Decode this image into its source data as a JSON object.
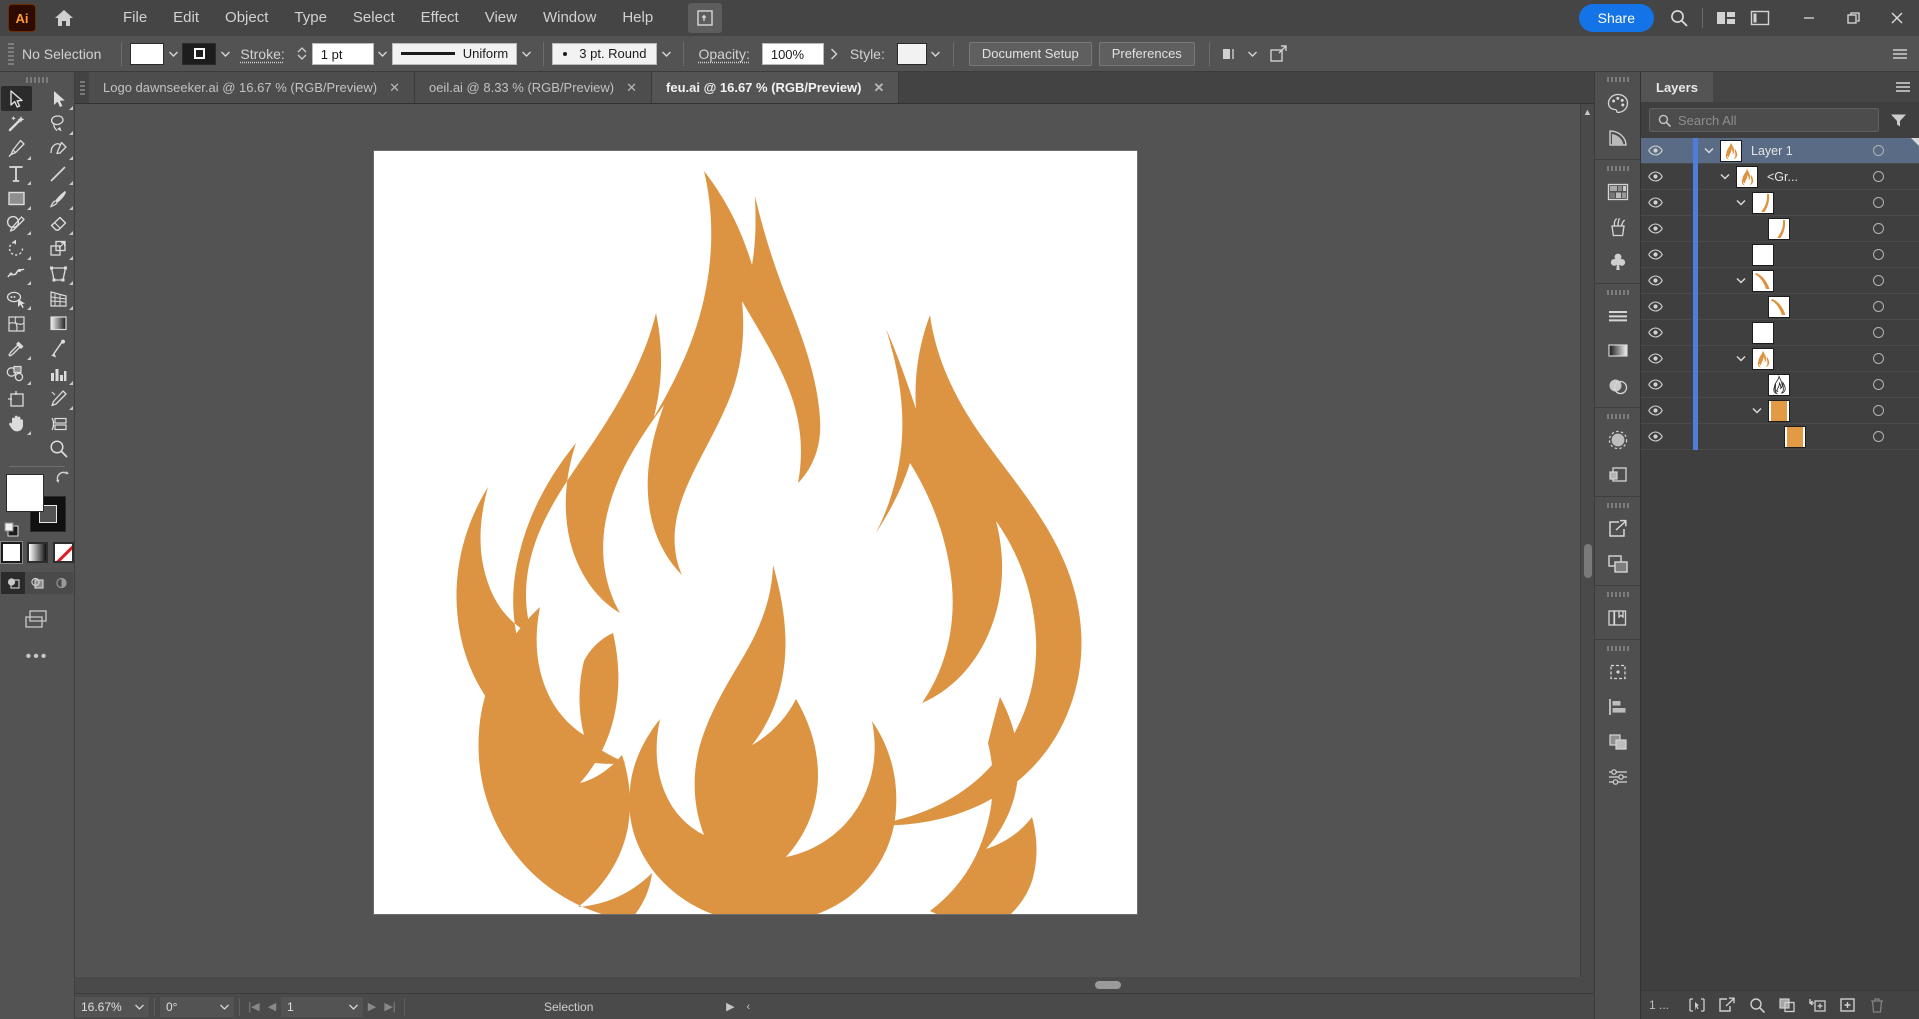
{
  "app": {
    "name": "Adobe Illustrator",
    "logo_text": "Ai"
  },
  "menubar": {
    "items": [
      {
        "label": "File"
      },
      {
        "label": "Edit"
      },
      {
        "label": "Object"
      },
      {
        "label": "Type"
      },
      {
        "label": "Select"
      },
      {
        "label": "Effect"
      },
      {
        "label": "View"
      },
      {
        "label": "Window"
      },
      {
        "label": "Help"
      }
    ],
    "share_label": "Share",
    "icons": {
      "home": "home-icon",
      "doc_arrange": "document-arrange-icon",
      "search": "search-icon",
      "workspace": "workspace-switcher-icon",
      "panel_toggle": "panel-toggle-icon",
      "minimize": "–",
      "maximize": "❐",
      "close": "✕"
    }
  },
  "controlbar": {
    "selection_status": "No Selection",
    "fill_color": "#ffffff",
    "stroke_color": "#1d1d1d",
    "stroke_label": "Stroke:",
    "stroke_weight": "1 pt",
    "stroke_profile": "Uniform",
    "stroke_cap": "3 pt. Round",
    "opacity_label": "Opacity:",
    "opacity_value": "100%",
    "style_label": "Style:",
    "document_setup_label": "Document Setup",
    "preferences_label": "Preferences"
  },
  "tabs": [
    {
      "label": "Logo dawnseeker.ai @ 16.67 % (RGB/Preview)",
      "active": false,
      "close": "✕"
    },
    {
      "label": "oeil.ai @ 8.33 % (RGB/Preview)",
      "active": false,
      "close": "✕"
    },
    {
      "label": "feu.ai @ 16.67 % (RGB/Preview)",
      "active": true,
      "close": "✕"
    }
  ],
  "toolbar": {
    "tools": [
      {
        "name": "selection-tool",
        "active": true
      },
      {
        "name": "direct-selection-tool",
        "active": false
      },
      {
        "name": "magic-wand-tool",
        "active": false
      },
      {
        "name": "lasso-tool",
        "active": false
      },
      {
        "name": "pen-tool",
        "active": false
      },
      {
        "name": "curvature-tool",
        "active": false
      },
      {
        "name": "type-tool",
        "active": false
      },
      {
        "name": "line-segment-tool",
        "active": false
      },
      {
        "name": "rectangle-tool",
        "active": false
      },
      {
        "name": "paintbrush-tool",
        "active": false
      },
      {
        "name": "shaper-tool",
        "active": false
      },
      {
        "name": "eraser-tool",
        "active": false
      },
      {
        "name": "rotate-tool",
        "active": false
      },
      {
        "name": "scale-tool",
        "active": false
      },
      {
        "name": "width-tool",
        "active": false
      },
      {
        "name": "free-transform-tool",
        "active": false
      },
      {
        "name": "shape-builder-tool",
        "active": false
      },
      {
        "name": "perspective-grid-tool",
        "active": false
      },
      {
        "name": "mesh-tool",
        "active": false
      },
      {
        "name": "gradient-tool",
        "active": false
      },
      {
        "name": "eyedropper-tool",
        "active": false
      },
      {
        "name": "blend-tool",
        "active": false
      },
      {
        "name": "symbol-sprayer-tool",
        "active": false
      },
      {
        "name": "column-graph-tool",
        "active": false
      },
      {
        "name": "artboard-tool",
        "active": false
      },
      {
        "name": "slice-tool",
        "active": false
      },
      {
        "name": "hand-tool",
        "active": false
      },
      {
        "name": "print-tiling-tool",
        "active": false
      },
      {
        "name": "zoom-tool",
        "active": false
      }
    ],
    "fill_color": "#ffffff",
    "stroke_color": "#111111",
    "color_modes": [
      {
        "name": "color-mode-fill",
        "selected": true
      },
      {
        "name": "color-mode-gradient",
        "selected": false
      },
      {
        "name": "color-mode-none",
        "selected": false
      }
    ],
    "draw_modes": [
      {
        "name": "draw-normal-mode",
        "selected": true
      },
      {
        "name": "draw-behind-mode",
        "selected": false
      },
      {
        "name": "draw-inside-mode",
        "selected": false
      }
    ],
    "more_tools": "•••"
  },
  "canvas": {
    "artboard_background": "#ffffff",
    "artwork_name": "flame-illustration",
    "artwork_color": "#dd9442"
  },
  "statusbar": {
    "zoom_level": "16.67%",
    "rotation": "0°",
    "page_number": "1",
    "tool_status": "Selection"
  },
  "rail": {
    "groups": [
      {
        "icons": [
          {
            "name": "color-panel-icon"
          },
          {
            "name": "color-guide-panel-icon"
          }
        ]
      },
      {
        "icons": [
          {
            "name": "swatches-panel-icon"
          },
          {
            "name": "brushes-panel-icon"
          },
          {
            "name": "symbols-panel-icon"
          }
        ]
      },
      {
        "icons": [
          {
            "name": "stroke-panel-icon"
          },
          {
            "name": "gradient-panel-icon"
          },
          {
            "name": "transparency-panel-icon"
          }
        ]
      },
      {
        "icons": [
          {
            "name": "appearance-panel-icon"
          },
          {
            "name": "graphic-styles-panel-icon"
          }
        ]
      },
      {
        "icons": [
          {
            "name": "export-panel-icon"
          },
          {
            "name": "layers-panel-icon"
          }
        ]
      },
      {
        "icons": [
          {
            "name": "libraries-panel-icon"
          }
        ]
      },
      {
        "icons": [
          {
            "name": "artboards-panel-icon"
          },
          {
            "name": "align-panel-icon"
          },
          {
            "name": "pathfinder-panel-icon"
          },
          {
            "name": "properties-panel-icon"
          }
        ]
      }
    ]
  },
  "layers_panel": {
    "tab_label": "Layers",
    "search_placeholder": "Search All",
    "menu_icon": "panel-menu-icon",
    "filter_icon": "filter-icon",
    "rows": [
      {
        "name": "Layer 1",
        "indent": 0,
        "selected": true,
        "has_disclosure": true,
        "thumb": "flame",
        "show_name": true
      },
      {
        "name": "<Gr...",
        "indent": 1,
        "selected": false,
        "has_disclosure": true,
        "thumb": "flame",
        "show_name": true
      },
      {
        "name": "",
        "indent": 2,
        "selected": false,
        "has_disclosure": true,
        "thumb": "curve",
        "show_name": false
      },
      {
        "name": "",
        "indent": 3,
        "selected": false,
        "has_disclosure": false,
        "thumb": "curve",
        "show_name": false
      },
      {
        "name": "",
        "indent": 2,
        "selected": false,
        "has_disclosure": false,
        "thumb": "blank",
        "show_name": false
      },
      {
        "name": "",
        "indent": 2,
        "selected": false,
        "has_disclosure": true,
        "thumb": "curve2",
        "show_name": false
      },
      {
        "name": "",
        "indent": 3,
        "selected": false,
        "has_disclosure": false,
        "thumb": "curve2",
        "show_name": false
      },
      {
        "name": "",
        "indent": 2,
        "selected": false,
        "has_disclosure": false,
        "thumb": "blank",
        "show_name": false
      },
      {
        "name": "",
        "indent": 2,
        "selected": false,
        "has_disclosure": true,
        "thumb": "flame",
        "show_name": false
      },
      {
        "name": "",
        "indent": 3,
        "selected": false,
        "has_disclosure": false,
        "thumb": "flameout",
        "show_name": false
      },
      {
        "name": "",
        "indent": 3,
        "selected": false,
        "has_disclosure": true,
        "thumb": "solid",
        "show_name": false
      },
      {
        "name": "",
        "indent": 4,
        "selected": false,
        "has_disclosure": false,
        "thumb": "solid",
        "show_name": false
      }
    ],
    "footer": {
      "count_label": "1 ...",
      "buttons": [
        {
          "name": "locate-object-button",
          "dim": false
        },
        {
          "name": "release-to-layers-button",
          "dim": false
        },
        {
          "name": "find-layer-button",
          "dim": false
        },
        {
          "name": "collect-for-export-button",
          "dim": false
        },
        {
          "name": "new-sublayer-button",
          "dim": false
        },
        {
          "name": "new-layer-button",
          "dim": false
        },
        {
          "name": "delete-layer-button",
          "dim": true
        }
      ]
    }
  },
  "colors": {
    "accent_blue": "#1473e6",
    "selection_blue": "#5a6b86",
    "layer_edge_blue": "#4f7ddb",
    "flame_orange": "#dd9442",
    "panel_bg": "#3f3f3f",
    "chrome_bg": "#535353"
  }
}
